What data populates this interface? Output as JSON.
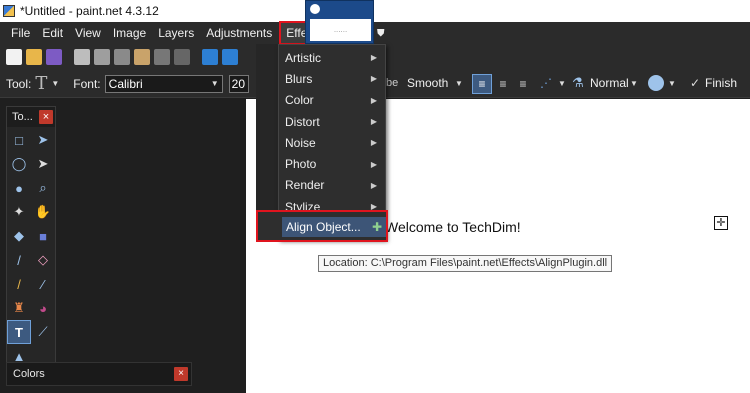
{
  "window": {
    "title": "*Untitled - paint.net 4.3.12"
  },
  "menu": [
    "File",
    "Edit",
    "View",
    "Image",
    "Layers",
    "Adjustments",
    "Effects"
  ],
  "toolbar2": {
    "tool_label": "Tool:",
    "font_label": "Font:",
    "font_value": "Calibri",
    "size_value": "20",
    "antialias_value": "Smooth",
    "blend_value": "Normal",
    "finish_label": "Finish"
  },
  "tools_panel": {
    "title": "To...",
    "close": "×"
  },
  "colors_panel": {
    "title": "Colors",
    "close": "×"
  },
  "effects_menu": {
    "items": [
      "Artistic",
      "Blurs",
      "Color",
      "Distort",
      "Noise",
      "Photo",
      "Render",
      "Stylize"
    ],
    "highlighted": "Align Object..."
  },
  "tooltip": "Location: C:\\Program Files\\paint.net\\Effects\\AlignPlugin.dll",
  "canvas": {
    "text": "Welcome to TechDim!"
  },
  "mini_panel": {
    "text": "......"
  },
  "colors": {
    "accent": "#e0141e",
    "menu_bg": "#2e2e2e",
    "highlight": "#3d5577"
  }
}
